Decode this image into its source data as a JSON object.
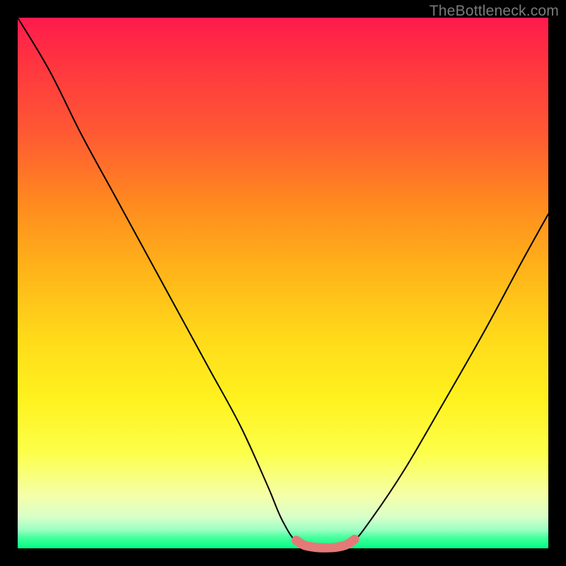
{
  "watermark": "TheBottleneck.com",
  "chart_data": {
    "type": "line",
    "title": "",
    "xlabel": "",
    "ylabel": "",
    "xlim": [
      0,
      100
    ],
    "ylim": [
      0,
      100
    ],
    "grid": false,
    "series": [
      {
        "name": "bottleneck-curve",
        "color": "#000000",
        "x": [
          0,
          6,
          12,
          18,
          24,
          30,
          36,
          42,
          47,
          50,
          53,
          58,
          60,
          63,
          67,
          73,
          80,
          88,
          95,
          100
        ],
        "values": [
          100,
          90,
          78,
          67,
          56,
          45,
          34,
          23,
          12,
          5,
          1,
          0,
          0,
          1,
          6,
          15,
          27,
          41,
          54,
          63
        ]
      },
      {
        "name": "flat-zone-highlight",
        "color": "#e47a78",
        "x": [
          52.5,
          54,
          56,
          58,
          60,
          62,
          63.5
        ],
        "values": [
          1.5,
          0.6,
          0.2,
          0.1,
          0.2,
          0.7,
          1.7
        ]
      }
    ],
    "annotations": []
  }
}
